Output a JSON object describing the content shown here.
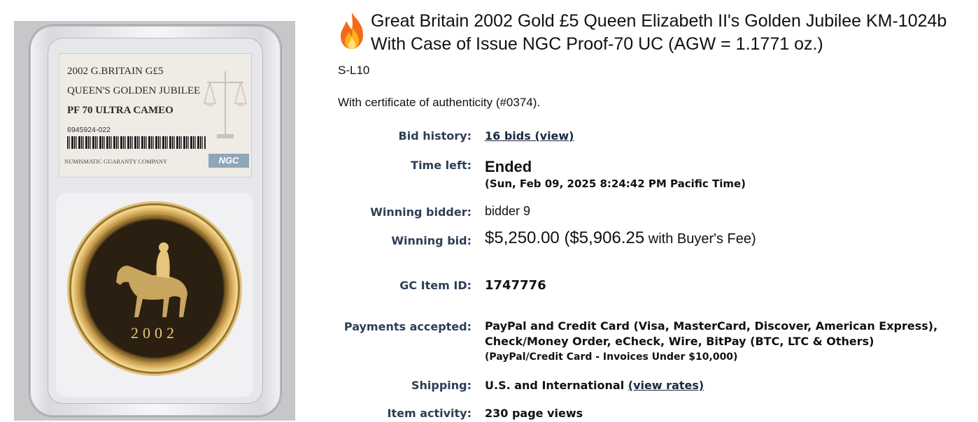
{
  "coin_image": {
    "label_line1": "2002 G.BRITAIN G£5",
    "label_line2": "QUEEN'S GOLDEN JUBILEE",
    "label_line3": "PF 70 ULTRA CAMEO",
    "cert_number": "6945924-022",
    "company": "NUMISMATIC GUARANTY COMPANY",
    "logo_text": "NGC",
    "coin_year": "2002"
  },
  "listing": {
    "hot_icon": "flame-icon",
    "title": "Great Britain 2002 Gold £5 Queen Elizabeth II's Golden Jubilee KM-1024b With Case of Issue NGC Proof-70 UC (AGW = 1.1771 oz.)",
    "sku": "S-L10",
    "description": "With certificate of authenticity (#0374)."
  },
  "details": {
    "bid_history_label": "Bid history:",
    "bid_history_link": "16 bids (view)",
    "time_left_label": "Time left:",
    "time_left_status": "Ended",
    "time_left_date": "(Sun, Feb 09, 2025 8:24:42 PM Pacific Time)",
    "winning_bidder_label": "Winning bidder:",
    "winning_bidder_value": "bidder 9",
    "winning_bid_label": "Winning bid:",
    "winning_bid_amount": "$5,250.00 ($5,906.25",
    "winning_bid_fee": "with Buyer's Fee)",
    "gc_item_label": "GC Item ID:",
    "gc_item_value": "1747776",
    "payments_label": "Payments accepted:",
    "payments_line1": "PayPal and Credit Card (Visa, MasterCard, Discover, American Express),",
    "payments_line2": "Check/Money Order, eCheck, Wire, BitPay (BTC, LTC & Others)",
    "payments_note": "(PayPal/Credit Card - Invoices Under $10,000)",
    "shipping_label": "Shipping:",
    "shipping_value": "U.S. and International",
    "shipping_link": "(view rates)",
    "activity_label": "Item activity:",
    "activity_value": "230 page views"
  },
  "colors": {
    "label": "#2c3e57",
    "text": "#111111",
    "flame": "#f26b1d"
  }
}
